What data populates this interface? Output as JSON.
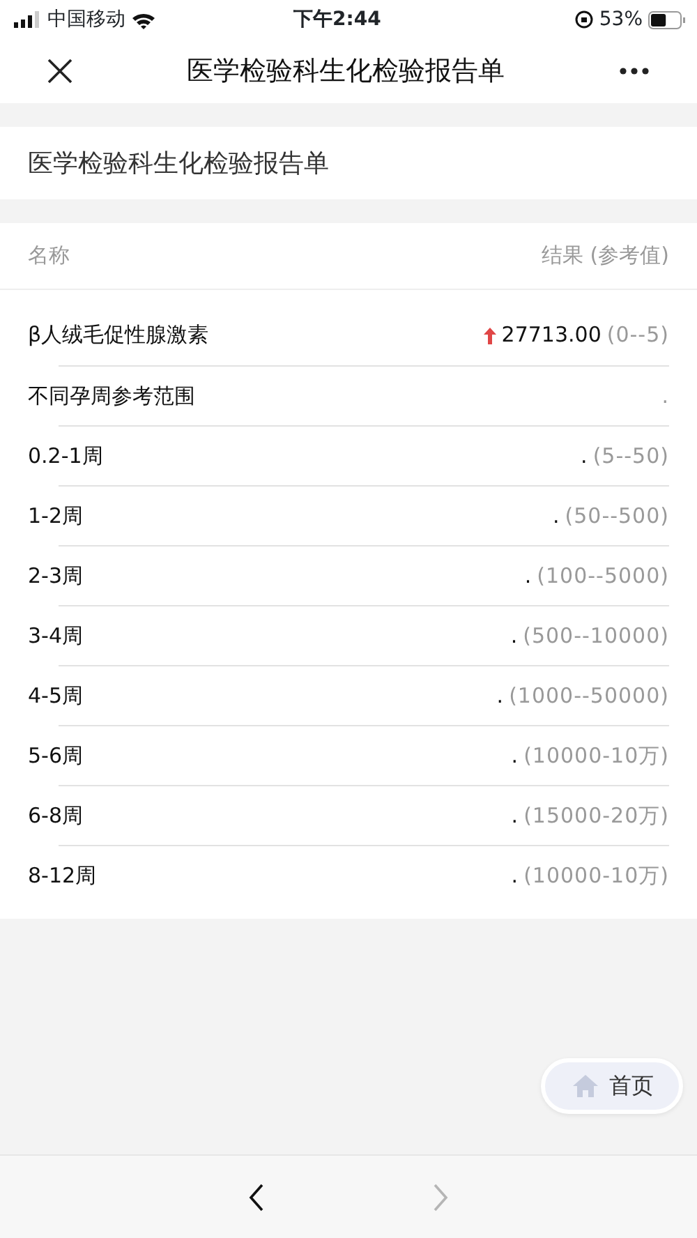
{
  "status_bar": {
    "carrier": "中国移动",
    "time": "下午2:44",
    "battery": "53%"
  },
  "nav": {
    "title": "医学检验科生化检验报告单"
  },
  "report_title": "医学检验科生化检验报告单",
  "table": {
    "columns": [
      "名称",
      "结果 (参考值)"
    ],
    "rows": [
      {
        "name": "β人绒毛促性腺激素",
        "value": "27713.00",
        "reference": "(0--5)",
        "high": true
      },
      {
        "name": "不同孕周参考范围",
        "reference": ".",
        "high": false
      },
      {
        "name": "0.2-1周",
        "value": ".",
        "reference": "(5--50)",
        "high": false
      },
      {
        "name": "1-2周",
        "value": ".",
        "reference": "(50--500)",
        "high": false
      },
      {
        "name": "2-3周",
        "value": ".",
        "reference": "(100--5000)",
        "high": false
      },
      {
        "name": "3-4周",
        "value": ".",
        "reference": "(500--10000)",
        "high": false
      },
      {
        "name": "4-5周",
        "value": ".",
        "reference": "(1000--50000)",
        "high": false
      },
      {
        "name": "5-6周",
        "value": ".",
        "reference": "(10000-10万)",
        "high": false
      },
      {
        "name": "6-8周",
        "value": ".",
        "reference": "(15000-20万)",
        "high": false
      },
      {
        "name": "8-12周",
        "value": ".",
        "reference": "(10000-10万)",
        "high": false
      }
    ]
  },
  "home_button": {
    "label": "首页"
  },
  "toolbar": {
    "back_disabled": false,
    "forward_disabled": true
  }
}
